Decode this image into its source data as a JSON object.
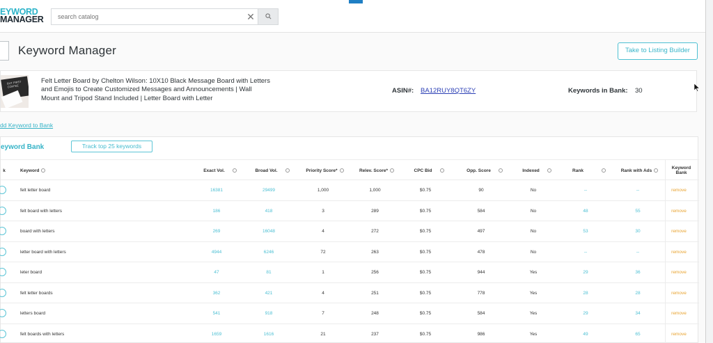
{
  "logo": {
    "line1": "EYWORD",
    "line2": "MANAGER"
  },
  "search": {
    "placeholder": "search catalog"
  },
  "page_title": "Keyword Manager",
  "listing_button": "Take to Listing Builder",
  "product": {
    "title": "Felt Letter Board by Chelton Wilson: 10X10 Black Message Board with Letters and Emojis to Create Customized Messages and Announcements | Wall Mount and Tripod Stand Included | Letter Board with Letter",
    "asin_label": "ASIN#:",
    "asin_value": "BA12RUY8QT6ZY",
    "keywords_label": "Keywords in Bank:",
    "keywords_count": "30",
    "thumb_text": "BUT FIRST COFFEE"
  },
  "add_keyword_link": "dd Keyword to Bank",
  "bank": {
    "title": "eyword Bank",
    "track_button": "Track top 25 keywords",
    "columns": {
      "select": "k",
      "keyword": "Keyword",
      "exact": "Exact Vol.",
      "broad": "Broad Vol.",
      "priority": "Priority Score*",
      "relev": "Relev. Score*",
      "cpc": "CPC Bid",
      "opp": "Opp. Score",
      "indexed": "Indexed",
      "rank": "Rank",
      "rank_ads": "Rank with Ads",
      "bank": "Keyword Bank"
    },
    "rows": [
      {
        "keyword": "felt letter board",
        "exact": "16381",
        "broad": "29499",
        "priority": "1,000",
        "relev": "1,000",
        "cpc": "$0.75",
        "opp": "90",
        "indexed": "No",
        "rank": "--",
        "rank_ads": "--",
        "action": "remove"
      },
      {
        "keyword": "felt board with letters",
        "exact": "186",
        "broad": "418",
        "priority": "3",
        "relev": "289",
        "cpc": "$0.75",
        "opp": "584",
        "indexed": "No",
        "rank": "48",
        "rank_ads": "55",
        "action": "remove"
      },
      {
        "keyword": "board with letters",
        "exact": "269",
        "broad": "16048",
        "priority": "4",
        "relev": "272",
        "cpc": "$0.75",
        "opp": "497",
        "indexed": "No",
        "rank": "53",
        "rank_ads": "30",
        "action": "remove"
      },
      {
        "keyword": "letter board with letters",
        "exact": "4944",
        "broad": "6246",
        "priority": "72",
        "relev": "263",
        "cpc": "$0.75",
        "opp": "478",
        "indexed": "No",
        "rank": "--",
        "rank_ads": "--",
        "action": "remove"
      },
      {
        "keyword": "leter board",
        "exact": "47",
        "broad": "81",
        "priority": "1",
        "relev": "256",
        "cpc": "$0.75",
        "opp": "944",
        "indexed": "Yes",
        "rank": "29",
        "rank_ads": "36",
        "action": "remove"
      },
      {
        "keyword": "felt letter boards",
        "exact": "362",
        "broad": "421",
        "priority": "4",
        "relev": "251",
        "cpc": "$0.75",
        "opp": "778",
        "indexed": "Yes",
        "rank": "28",
        "rank_ads": "28",
        "action": "remove"
      },
      {
        "keyword": "letters board",
        "exact": "541",
        "broad": "918",
        "priority": "7",
        "relev": "248",
        "cpc": "$0.75",
        "opp": "584",
        "indexed": "Yes",
        "rank": "29",
        "rank_ads": "34",
        "action": "remove"
      },
      {
        "keyword": "felt boards with letters",
        "exact": "1659",
        "broad": "1616",
        "priority": "21",
        "relev": "237",
        "cpc": "$0.75",
        "opp": "986",
        "indexed": "Yes",
        "rank": "49",
        "rank_ads": "65",
        "action": "remove"
      }
    ]
  },
  "colors": {
    "accent": "#35b3c7",
    "link": "#2b3fb5",
    "remove": "#e8a22d"
  }
}
